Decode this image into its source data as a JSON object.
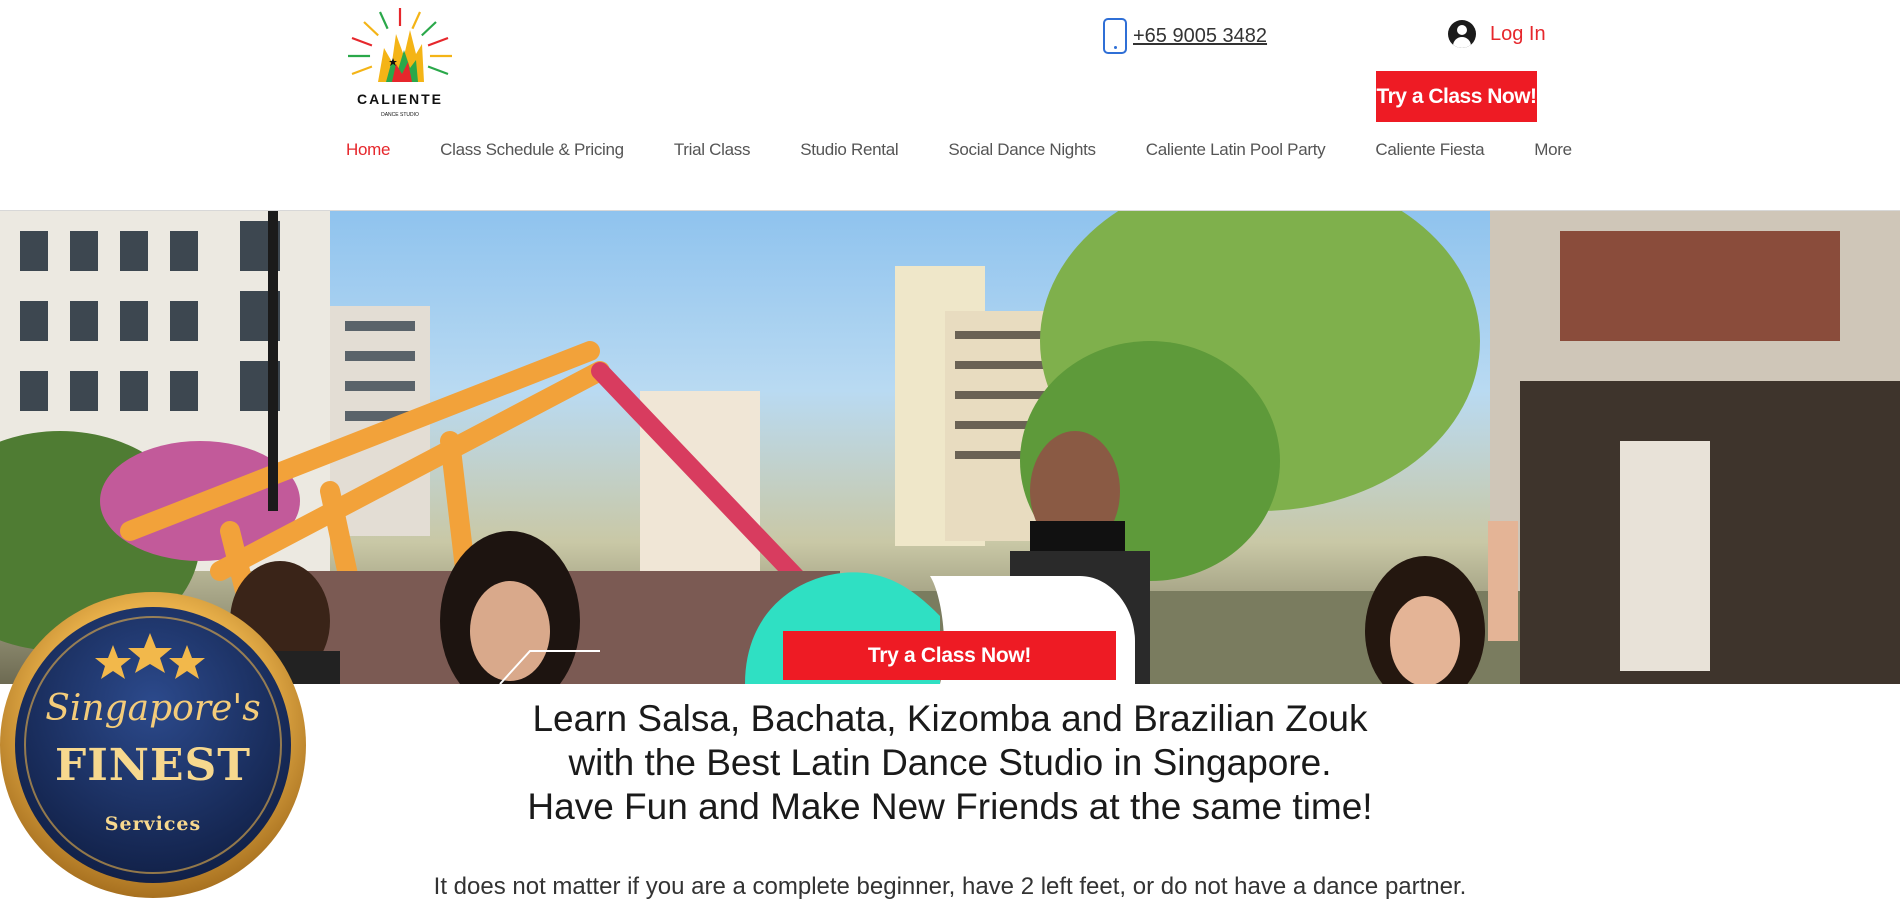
{
  "header": {
    "logo_text": "CALIENTE",
    "logo_subtext": "DANCE STUDIO",
    "phone": "+65 9005 3482",
    "login_label": "Log In",
    "cta_label": "Try a Class Now!"
  },
  "nav": {
    "items": [
      {
        "label": "Home",
        "active": true
      },
      {
        "label": "Class Schedule & Pricing"
      },
      {
        "label": "Trial Class"
      },
      {
        "label": "Studio Rental"
      },
      {
        "label": "Social Dance Nights"
      },
      {
        "label": "Caliente Latin Pool Party"
      },
      {
        "label": "Caliente Fiesta"
      },
      {
        "label": "More"
      }
    ]
  },
  "hero": {
    "cta_label": "Try a Class Now!"
  },
  "content": {
    "headline": [
      "Learn Salsa, Bachata, Kizomba and Brazilian Zouk",
      "with the Best Latin Dance Studio in Singapore.",
      "Have Fun and Make New Friends at the same time!"
    ],
    "subtext": "It does not matter if you are a complete beginner, have 2 left feet, or do not have a dance partner."
  },
  "badge": {
    "line1": "Singapore's",
    "line2": "FINEST",
    "line3": "Services"
  },
  "colors": {
    "brand_red": "#ee1b24",
    "nav_active": "#e6272c",
    "badge_gold": "#e8b04a",
    "badge_navy": "#172b5a",
    "teal": "#2fe0c3"
  }
}
